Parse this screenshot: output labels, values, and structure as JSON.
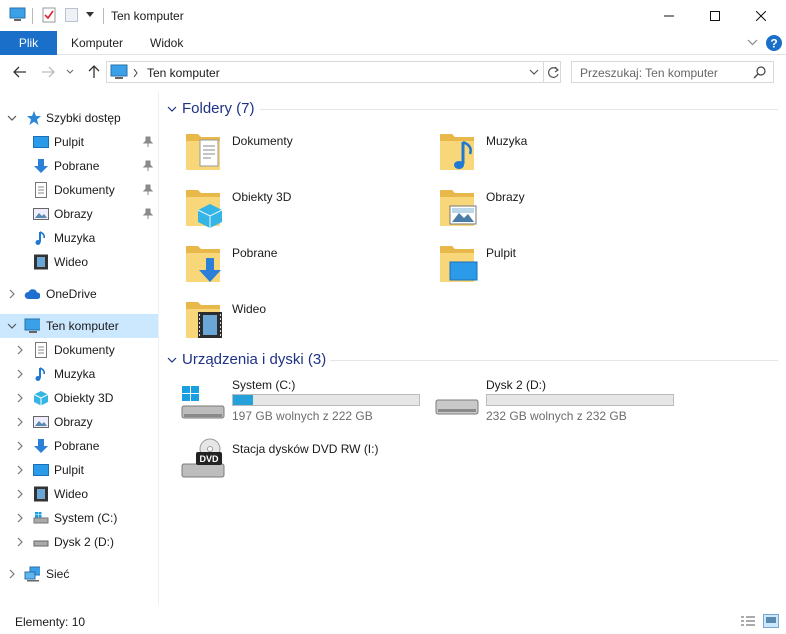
{
  "window": {
    "title": "Ten komputer"
  },
  "ribbon": {
    "tabs": [
      "Plik",
      "Komputer",
      "Widok"
    ]
  },
  "address": {
    "path": "Ten komputer"
  },
  "search": {
    "placeholder": "Przeszukaj: Ten komputer"
  },
  "sidebar": {
    "quick_access": {
      "label": "Szybki dostęp",
      "items": [
        {
          "label": "Pulpit",
          "icon": "desktop-icon",
          "pinned": true
        },
        {
          "label": "Pobrane",
          "icon": "download-icon",
          "pinned": true
        },
        {
          "label": "Dokumenty",
          "icon": "document-icon",
          "pinned": true
        },
        {
          "label": "Obrazy",
          "icon": "pictures-icon",
          "pinned": true
        },
        {
          "label": "Muzyka",
          "icon": "music-icon",
          "pinned": false
        },
        {
          "label": "Wideo",
          "icon": "video-icon",
          "pinned": false
        }
      ]
    },
    "onedrive": {
      "label": "OneDrive"
    },
    "this_pc": {
      "label": "Ten komputer",
      "items": [
        {
          "label": "Dokumenty",
          "icon": "document-icon"
        },
        {
          "label": "Muzyka",
          "icon": "music-icon"
        },
        {
          "label": "Obiekty 3D",
          "icon": "cube-icon"
        },
        {
          "label": "Obrazy",
          "icon": "pictures-icon"
        },
        {
          "label": "Pobrane",
          "icon": "download-icon"
        },
        {
          "label": "Pulpit",
          "icon": "desktop-icon"
        },
        {
          "label": "Wideo",
          "icon": "video-icon"
        },
        {
          "label": "System (C:)",
          "icon": "drive-c-icon"
        },
        {
          "label": "Dysk 2 (D:)",
          "icon": "drive-icon"
        }
      ]
    },
    "network": {
      "label": "Sieć"
    }
  },
  "content": {
    "folders_header": "Foldery (7)",
    "folders": [
      {
        "label": "Dokumenty",
        "icon": "folder-documents-icon"
      },
      {
        "label": "Muzyka",
        "icon": "folder-music-icon"
      },
      {
        "label": "Obiekty 3D",
        "icon": "folder-3d-icon"
      },
      {
        "label": "Obrazy",
        "icon": "folder-pictures-icon"
      },
      {
        "label": "Pobrane",
        "icon": "folder-downloads-icon"
      },
      {
        "label": "Pulpit",
        "icon": "folder-desktop-icon"
      },
      {
        "label": "Wideo",
        "icon": "folder-video-icon"
      }
    ],
    "devices_header": "Urządzenia i dyski (3)",
    "drives": [
      {
        "label": "System (C:)",
        "free": "197 GB wolnych z 222 GB",
        "used_fraction": 0.11
      },
      {
        "label": "Dysk 2 (D:)",
        "free": "232 GB wolnych z 232 GB",
        "used_fraction": 0.0
      },
      {
        "label": "Stacja dysków DVD RW (I:)",
        "dvd_label": "DVD"
      }
    ]
  },
  "status": {
    "items": "Elementy: 10"
  },
  "colors": {
    "accent": "#1a6fc9",
    "selection": "#cce8ff",
    "header": "#1e3287",
    "bar_fill": "#26a0da"
  }
}
